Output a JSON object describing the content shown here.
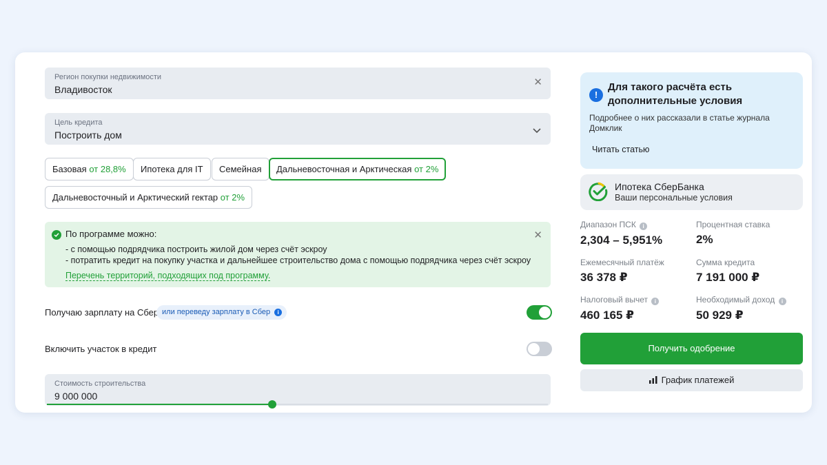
{
  "form": {
    "region": {
      "label": "Регион покупки недвижимости",
      "value": "Владивосток"
    },
    "purpose": {
      "label": "Цель кредита",
      "value": "Построить дом"
    },
    "programs": [
      {
        "name": "Базовая",
        "rate": "от 28,8%"
      },
      {
        "name": "Ипотека для IT",
        "rate": ""
      },
      {
        "name": "Семейная",
        "rate": ""
      },
      {
        "name": "Дальневосточная и Арктическая",
        "rate": "от 2%"
      },
      {
        "name": "Дальневосточный и Арктический гектар",
        "rate": "от 2%"
      }
    ],
    "notice": {
      "title": "По программе можно:",
      "lines": [
        "- с помощью подрядчика построить жилой дом через счёт эскроу",
        "- потратить кредит на покупку участка и дальнейшее строительство дома с помощью подрядчика через счёт эскроу"
      ],
      "link": "Перечень территорий, подходящих под программу."
    },
    "salary": {
      "label": "Получаю зарплату на Сбер",
      "badge": "или переведу зарплату в Сбер",
      "enabled": true
    },
    "plot": {
      "label": "Включить участок в кредит",
      "enabled": false
    },
    "cost": {
      "label": "Стоимость строительства",
      "value": "9 000 000",
      "slider_fraction": 0.45
    }
  },
  "sidebar": {
    "info": {
      "title": "Для такого расчёта есть дополнительные условия",
      "text": "Подробнее о них рассказали в статье журнала Домклик",
      "link": "Читать статью"
    },
    "offer": {
      "title": "Ипотека СберБанка",
      "subtitle": "Ваши персональные условия"
    },
    "stats": {
      "psk": {
        "label": "Диапазон ПСК",
        "value": "2,304 – 5,951%"
      },
      "rate": {
        "label": "Процентная ставка",
        "value": "2%"
      },
      "payment": {
        "label": "Ежемесячный платёж",
        "value": "36 378 ₽"
      },
      "amount": {
        "label": "Сумма кредита",
        "value": "7 191 000 ₽"
      },
      "tax": {
        "label": "Налоговый вычет",
        "value": "460 165 ₽"
      },
      "income": {
        "label": "Необходимый доход",
        "value": "50 929 ₽"
      }
    },
    "approve_button": "Получить одобрение",
    "schedule_button": "График платежей"
  },
  "colors": {
    "accent": "#21a038",
    "info_bg": "#dff0fb",
    "notice_bg": "#e3f4e6",
    "page_bg": "#eef4fd"
  }
}
